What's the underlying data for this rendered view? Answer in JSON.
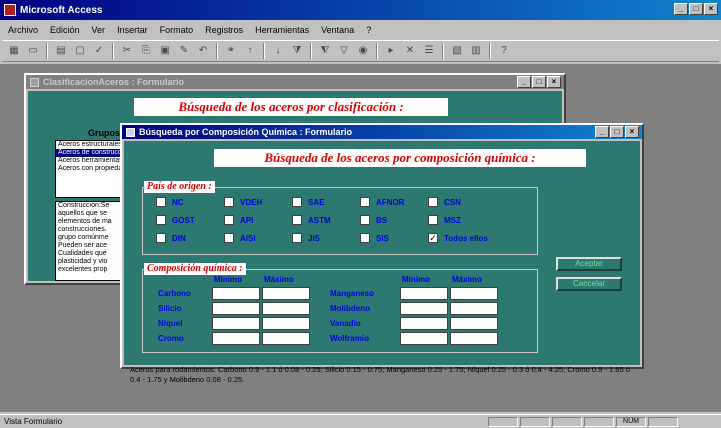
{
  "app": {
    "title": "Microsoft Access",
    "window_controls": [
      "_",
      "□",
      "×"
    ]
  },
  "menu": [
    "Archivo",
    "Edición",
    "Ver",
    "Insertar",
    "Formato",
    "Registros",
    "Herramientas",
    "Ventana",
    "?"
  ],
  "toolbar": {
    "icons": [
      "design-view-icon",
      "save-icon",
      "print-icon",
      "print-preview-icon",
      "spelling-icon",
      "cut-icon",
      "copy-icon",
      "paste-icon",
      "format-painter-icon",
      "undo-icon",
      "insert-hyperlink-icon",
      "sort-ascending-icon",
      "sort-descending-icon",
      "filter-by-selection-icon",
      "filter-by-form-icon",
      "apply-filter-icon",
      "find-icon",
      "new-record-icon",
      "delete-record-icon",
      "properties-icon",
      "database-window-icon",
      "new-object-icon",
      "help-icon"
    ],
    "glyphs": [
      "▦",
      "▭",
      "▤",
      "▢",
      "✓",
      "✂",
      "⎘",
      "▣",
      "✎",
      "↶",
      "⚭",
      "↑",
      "↓",
      "⧩",
      "⧨",
      "▽",
      "◉",
      "▸",
      "✕",
      "☰",
      "▧",
      "▥",
      "?"
    ]
  },
  "win1": {
    "title": "ClasificacionAceros : Formulario",
    "heading": "Búsqueda de los aceros por clasificación :",
    "grupo_label": "Grupos",
    "grupos": [
      "Aceros estructurales",
      "Aceros de construcción",
      "Aceros herramientas",
      "Aceros con propiedades"
    ],
    "selected_index": 1,
    "description": [
      "Construcción:Se",
      "aquellos que se",
      "elementos de ma",
      "construcciones.",
      "grupo comúnme",
      "Pueden ser ace",
      "Cualidades que",
      "plasticidad y vio",
      "excelentes prop"
    ]
  },
  "win2": {
    "title": "Búsqueda por Composición Química : Formulario",
    "heading": "Búsqueda de los aceros por composición química :",
    "pais_label": "País de origen :",
    "countries": [
      {
        "label": "NC",
        "checked": false
      },
      {
        "label": "VDEH",
        "checked": false
      },
      {
        "label": "SAE",
        "checked": false
      },
      {
        "label": "AFNOR",
        "checked": false
      },
      {
        "label": "CSN",
        "checked": false
      },
      {
        "label": "GOST",
        "checked": false
      },
      {
        "label": "API",
        "checked": false
      },
      {
        "label": "ASTM",
        "checked": false
      },
      {
        "label": "BS",
        "checked": false
      },
      {
        "label": "MSZ",
        "checked": false
      },
      {
        "label": "DIN",
        "checked": false
      },
      {
        "label": "AISI",
        "checked": false
      },
      {
        "label": "JIS",
        "checked": false
      },
      {
        "label": "SIS",
        "checked": false
      },
      {
        "label": "Todos ellos",
        "checked": true
      }
    ],
    "comp_label": "Composición química :",
    "col_min": "Mínimo",
    "col_max": "Máximo",
    "elements_left": [
      "Carbono",
      "Silicio",
      "Níquel",
      "Cromo"
    ],
    "elements_right": [
      "Manganeso",
      "Molibdeno",
      "Vanadio",
      "Wolframio"
    ],
    "btn_accept": "Aceptar",
    "btn_cancel": "Cancelar",
    "footnote": "Aceros para rodamientos:      Carbono 0.9 - 1.1 ó 0.08 - 0.25; Silicio 0.15 - 0.75; Manganeso 0.25 - 1.75; Níquel 0.25 - 0.3 ó 0.4 - 4.25; Cromo 0.9 - 1.65 ó 0.4 - 1.75 y Molibdeno 0.08 - 0.25."
  },
  "status": {
    "text": "Vista Formulario",
    "indicator": "NUM"
  }
}
